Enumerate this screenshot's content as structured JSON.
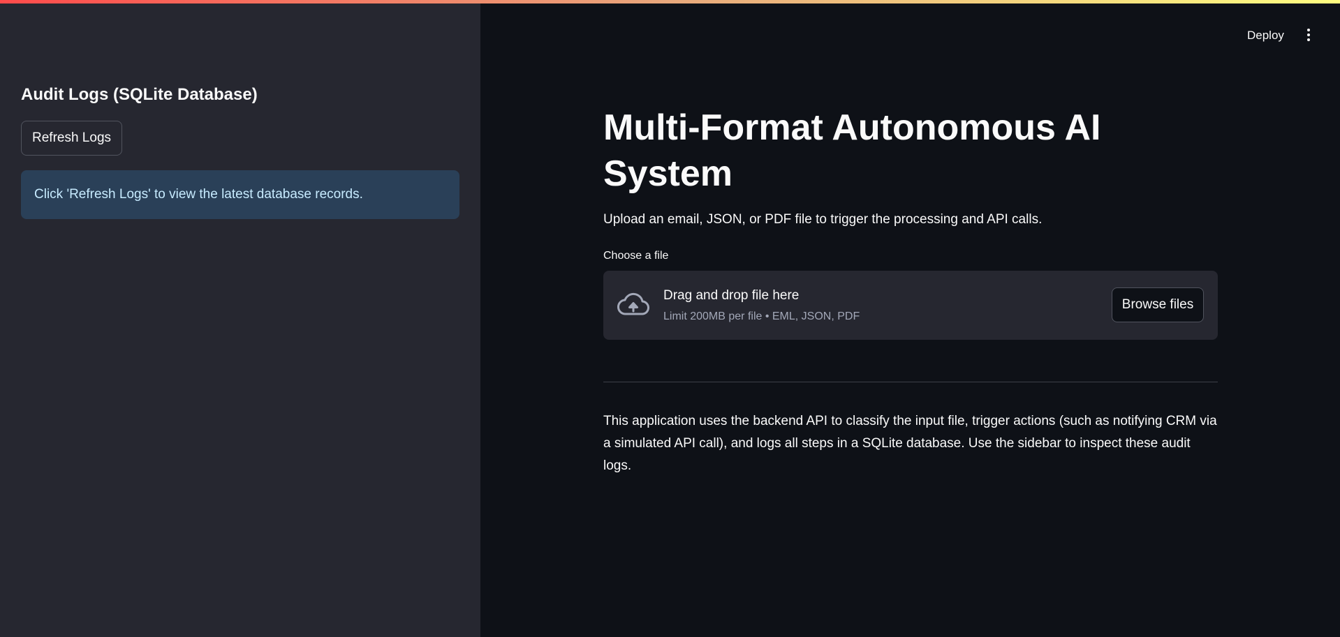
{
  "header": {
    "deploy_label": "Deploy",
    "menu_icon": "kebab-menu-icon"
  },
  "sidebar": {
    "title": "Audit Logs (SQLite Database)",
    "refresh_label": "Refresh Logs",
    "info_message": "Click 'Refresh Logs' to view the latest database records."
  },
  "main": {
    "title": "Multi-Format Autonomous AI System",
    "subtitle": "Upload an email, JSON, or PDF file to trigger the processing and API calls.",
    "uploader": {
      "label": "Choose a file",
      "icon": "cloud-upload-icon",
      "drop_title": "Drag and drop file here",
      "limit_text": "Limit 200MB per file • EML, JSON, PDF",
      "browse_label": "Browse files"
    },
    "description": "This application uses the backend API to classify the input file, trigger actions (such as notifying CRM via a simulated API call), and logs all steps in a SQLite database. Use the sidebar to inspect these audit logs."
  },
  "colors": {
    "background": "#0e1117",
    "sidebar_background": "#262730",
    "info_background": "#2a4058",
    "info_text": "#c7ebff",
    "text": "#fafafa",
    "muted_text": "#a3a8b8",
    "accent_gradient_start": "#ff4b4b",
    "accent_gradient_end": "#fffd80"
  }
}
